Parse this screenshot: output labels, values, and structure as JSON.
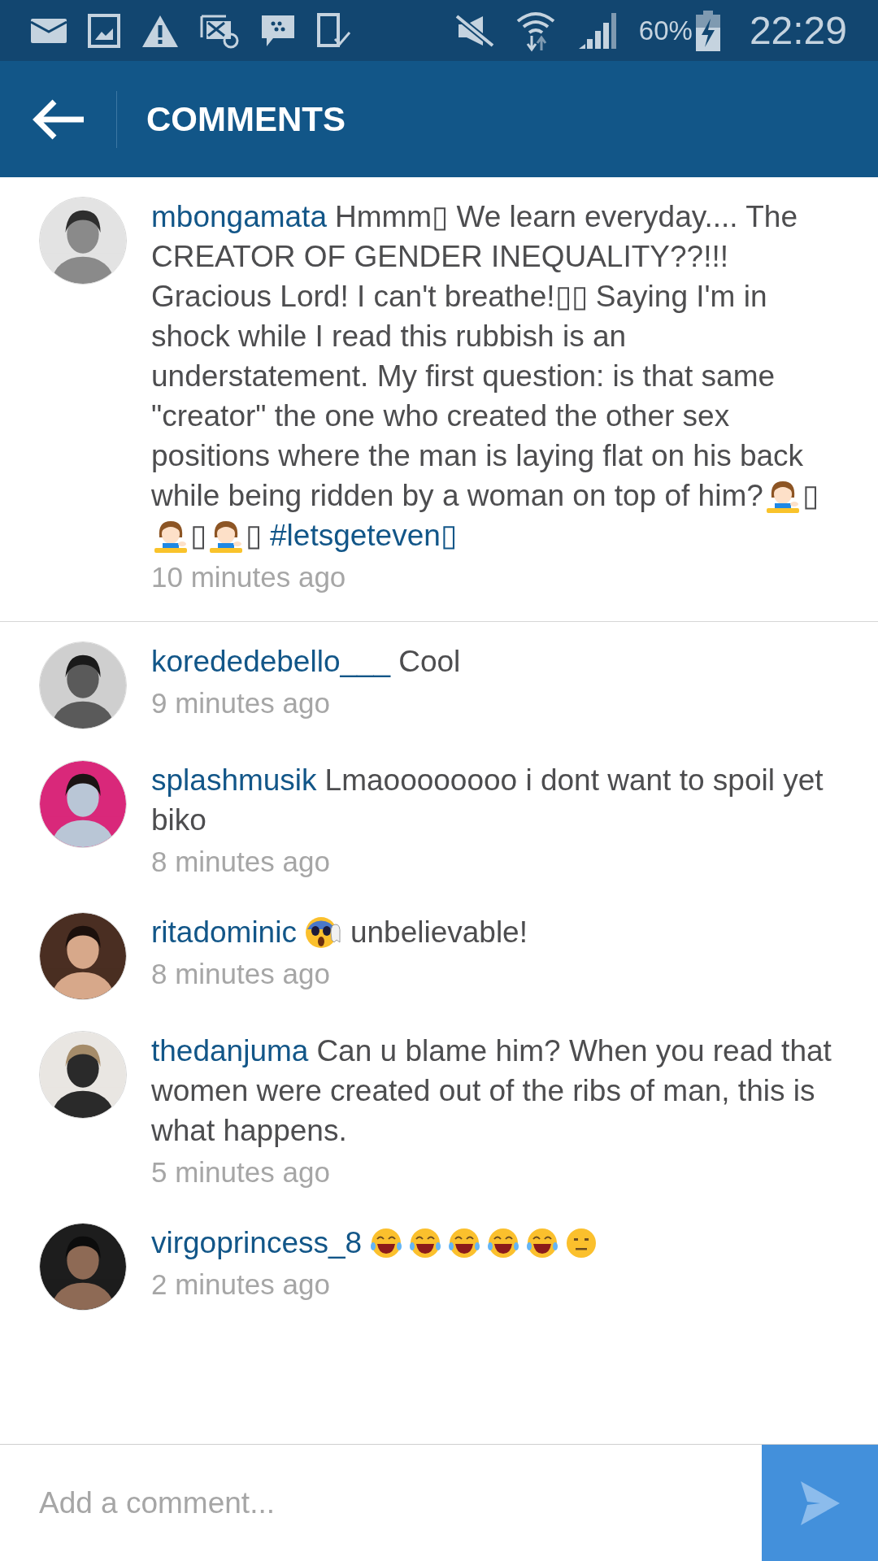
{
  "status_bar": {
    "battery": "60%",
    "time": "22:29"
  },
  "header": {
    "title": "COMMENTS"
  },
  "caption": {
    "user": "mbongamata",
    "parts": [
      {
        "kind": "text",
        "text": "Hmmm▯ We learn everyday.... The CREATOR OF GENDER INEQUALITY??!!! Gracious Lord! I can't breathe!▯▯ Saying I'm in shock while I read this rubbish is an understatement. My first question: is that same \"creator\" the one who created the other sex positions where the man is laying flat on his back while being ridden by a woman on top of him?"
      },
      {
        "kind": "tipping"
      },
      {
        "kind": "text",
        "text": "▯"
      },
      {
        "kind": "tipping"
      },
      {
        "kind": "text",
        "text": "▯"
      },
      {
        "kind": "tipping"
      },
      {
        "kind": "text",
        "text": "▯"
      },
      {
        "kind": "hashtag",
        "text": "#letsgeteven▯"
      }
    ],
    "time": "10 minutes ago"
  },
  "comments": [
    {
      "user": "korededebello___",
      "parts": [
        {
          "kind": "text",
          "text": "Cool"
        }
      ],
      "time": "9 minutes ago"
    },
    {
      "user": "splashmusik",
      "parts": [
        {
          "kind": "text",
          "text": "Lmaoooooooo i dont want to spoil yet biko"
        }
      ],
      "time": "8 minutes ago"
    },
    {
      "user": "ritadominic",
      "parts": [
        {
          "kind": "scream"
        },
        {
          "kind": "text",
          "text": "unbelievable!"
        }
      ],
      "time": "8 minutes ago"
    },
    {
      "user": "thedanjuma",
      "parts": [
        {
          "kind": "text",
          "text": "Can u blame him? When you read that women were created out of the ribs of man, this is what happens."
        }
      ],
      "time": "5 minutes ago"
    },
    {
      "user": "virgoprincess_8",
      "parts": [
        {
          "kind": "laugh"
        },
        {
          "kind": "laugh"
        },
        {
          "kind": "laugh"
        },
        {
          "kind": "laugh"
        },
        {
          "kind": "laugh"
        },
        {
          "kind": "neutral"
        }
      ],
      "time": "2 minutes ago"
    }
  ],
  "composer": {
    "placeholder": "Add a comment..."
  }
}
